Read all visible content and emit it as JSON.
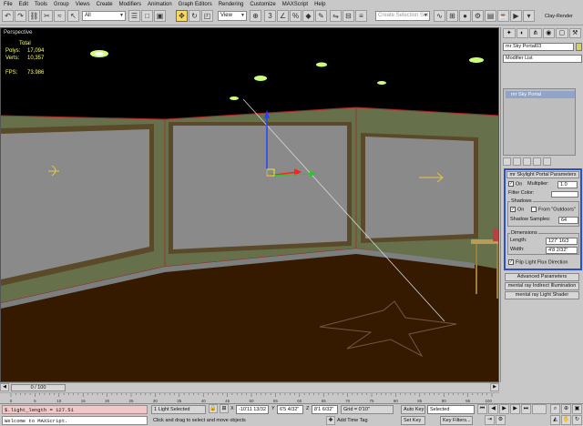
{
  "menu": [
    "File",
    "Edit",
    "Tools",
    "Group",
    "Views",
    "Create",
    "Modifiers",
    "Animation",
    "Graph Editors",
    "Rendering",
    "Customize",
    "MAXScript",
    "Help"
  ],
  "toolbar": {
    "filter_value": "All",
    "coord_value": "View",
    "selection_set_placeholder": "Create Selection Set",
    "clay_render_label": "Clay-Render"
  },
  "viewport": {
    "label": "Perspective",
    "stats": {
      "total_label": "Total",
      "polys_label": "Polys:",
      "polys_value": "17,094",
      "verts_label": "Verts:",
      "verts_value": "10,357",
      "fps_label": "FPS:",
      "fps_value": "73.986"
    }
  },
  "command_panel": {
    "object_name": "mr Sky Portal03",
    "modifier_list": "Modifier List",
    "stack_item": "mr Sky Portal",
    "rollout_title": "mr Skylight Portal Parameters",
    "on_label": "On",
    "multiplier_label": "Multiplier:",
    "multiplier_value": "1.0",
    "filter_color_label": "Filter Color:",
    "shadows_label": "Shadows",
    "shadows_on_label": "On",
    "from_outdoors_label": "From \"Outdoors\"",
    "shadow_samples_label": "Shadow Samples:",
    "shadow_samples_value": "64",
    "dimensions_label": "Dimensions",
    "length_label": "Length:",
    "length_value": "127' 16/3",
    "width_label": "Width:",
    "width_value": "4'8 2/32\"",
    "flip_label": "Flip Light Flux Direction",
    "advanced_label": "Advanced Parameters",
    "indirect_label": "mental ray Indirect Illumination",
    "shader_label": "mental ray Light Shader"
  },
  "timeline": {
    "frame_counter": "0 / 100",
    "ticks": [
      "0",
      "5",
      "10",
      "15",
      "20",
      "25",
      "30",
      "35",
      "40",
      "45",
      "50",
      "55",
      "60",
      "65",
      "70",
      "75",
      "80",
      "85",
      "90",
      "95",
      "100"
    ]
  },
  "status": {
    "maxscript_result": "$.light_length = 127.51",
    "maxscript_welcome": "Welcome to MAXScript.",
    "selection_info": "1 Light Selected",
    "prompt": "Click and drag to select and move objects",
    "x_label": "X",
    "x_value": "-10'11 13/32",
    "y_label": "Y",
    "y_value": "6'5 4/32\"",
    "z_label": "Z",
    "z_value": "8'1 6/32\"",
    "grid_label": "Grid = 0'10\"",
    "add_time_tag": "Add Time Tag",
    "auto_key": "Auto Key",
    "set_key": "Set Key",
    "key_selected": "Selected",
    "key_filters": "Key Filters..."
  },
  "colors": {
    "wall": "#66704a",
    "floor": "#361a00",
    "ceiling": "#000000",
    "window_glass": "#8a8a8a",
    "highlight_border": "#2e4fc4"
  }
}
